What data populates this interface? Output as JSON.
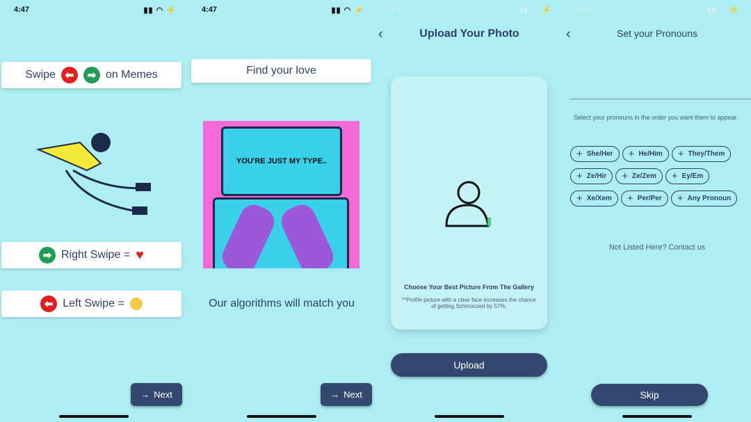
{
  "screens": [
    {
      "time": "4:47",
      "swipe_label": "Swipe",
      "memes_label": "on Memes",
      "right_swipe": "Right Swipe =",
      "left_swipe": "Left Swipe =",
      "next": "Next"
    },
    {
      "time": "4:47",
      "find_love": "Find your love",
      "laptop_text": "YOU'RE JUST MY TYPE..",
      "caption": "Our algorithms will match you",
      "next": "Next"
    },
    {
      "time": "4:47",
      "title": "Upload Your Photo",
      "choose": "Choose Your Best Picture From The Gallery",
      "hint": "**Profile picture with a clear face increases the chance of getting Schmoozed by 57%.",
      "upload": "Upload"
    },
    {
      "time": "4:51",
      "title": "Set your Pronouns",
      "instruction": "Select your pronouns in the order you want them to appear.",
      "pronouns": [
        [
          "She/Her",
          "He/Him",
          "They/Them"
        ],
        [
          "Ze/Hir",
          "Ze/Zem",
          "Ey/Em"
        ],
        [
          "Xe/Xem",
          "Per/Per",
          "Any Pronoun"
        ]
      ],
      "contact": "Not Listed Here? Contact us",
      "skip": "Skip"
    }
  ],
  "colors": {
    "background": "#aeeef2",
    "primary": "#34476e",
    "red": "#e02020",
    "green": "#1f9d55"
  }
}
